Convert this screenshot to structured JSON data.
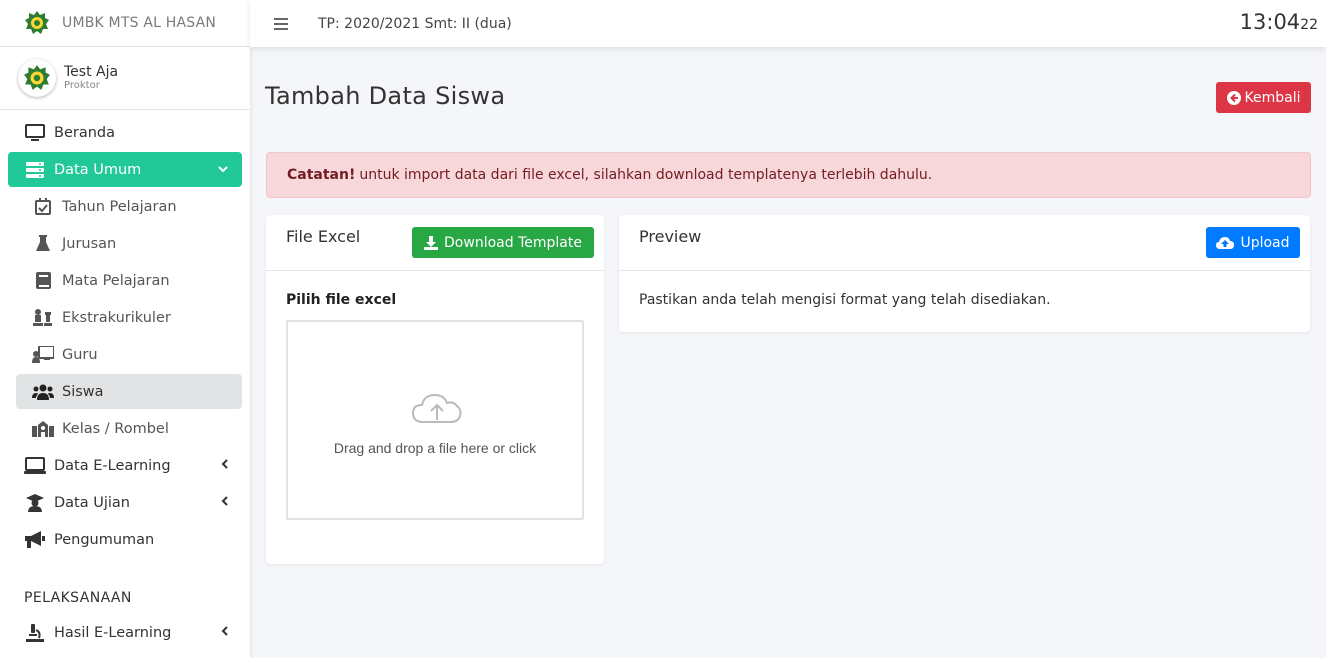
{
  "brand": {
    "name": "UMBK MTS AL HASAN",
    "logo_icon": "school-emblem-icon"
  },
  "user": {
    "name": "Test Aja",
    "role": "Proktor"
  },
  "topbar": {
    "period": "TP: 2020/2021 Smt: II (dua)",
    "clock_hm": "13:04",
    "clock_s": "22"
  },
  "sidebar": {
    "items": [
      {
        "label": "Beranda",
        "icon": "monitor-icon"
      },
      {
        "label": "Data Umum",
        "icon": "server-icon",
        "active": true,
        "expanded": true
      },
      {
        "label": "Data E-Learning",
        "icon": "laptop-icon"
      },
      {
        "label": "Data Ujian",
        "icon": "graduate-icon"
      },
      {
        "label": "Pengumuman",
        "icon": "megaphone-icon"
      }
    ],
    "sub_items": [
      {
        "label": "Tahun Pelajaran",
        "icon": "calendar-check-icon"
      },
      {
        "label": "Jurusan",
        "icon": "flask-icon"
      },
      {
        "label": "Mata Pelajaran",
        "icon": "book-icon"
      },
      {
        "label": "Ekstrakurikuler",
        "icon": "chess-icon"
      },
      {
        "label": "Guru",
        "icon": "teacher-icon"
      },
      {
        "label": "Siswa",
        "icon": "users-icon",
        "selected": true
      },
      {
        "label": "Kelas / Rombel",
        "icon": "school-icon"
      }
    ],
    "section_header": "PELAKSANAAN",
    "bottom_items": [
      {
        "label": "Hasil E-Learning",
        "icon": "microscope-icon"
      }
    ]
  },
  "page": {
    "title": "Tambah Data Siswa",
    "back_button": "Kembali",
    "alert_strong": "Catatan!",
    "alert_text": "untuk import data dari file excel, silahkan download templatenya terlebih dahulu."
  },
  "excel_card": {
    "title": "File Excel",
    "download_button": "Download Template",
    "field_label": "Pilih file excel",
    "dropzone_text": "Drag and drop a file here or click"
  },
  "preview_card": {
    "title": "Preview",
    "upload_button": "Upload",
    "body_text": "Pastikan anda telah mengisi format yang telah disediakan."
  },
  "colors": {
    "accent": "#20c997",
    "danger": "#dc3545",
    "success": "#28a745",
    "primary": "#007bff",
    "alert_bg": "#f8d7da"
  }
}
